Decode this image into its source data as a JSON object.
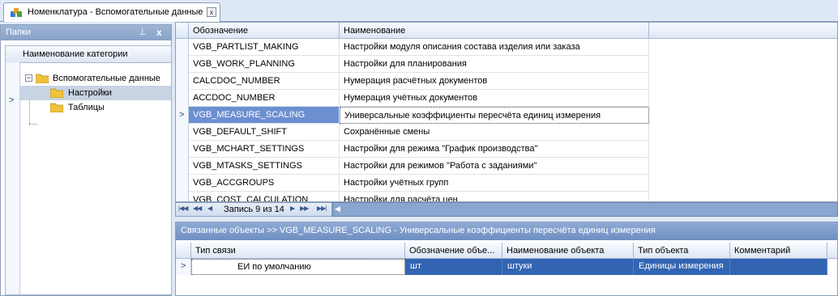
{
  "tab": {
    "title": "Номенклатура - Вспомогательные данные",
    "close_glyph": "x"
  },
  "left_panel": {
    "title": "Папки",
    "pin_glyph": "⊥",
    "close_glyph": "x",
    "tree_header": "Наименование категории",
    "tree": [
      {
        "label": "Вспомогательные данные",
        "expanded": true
      },
      {
        "label": "Настройки",
        "selected": true
      },
      {
        "label": "Таблицы"
      }
    ]
  },
  "grid": {
    "columns": [
      "Обозначение",
      "Наименование"
    ],
    "rows": [
      {
        "code": "VGB_PARTLIST_MAKING",
        "name": "Настройки модуля описания состава изделия или заказа"
      },
      {
        "code": "VGB_WORK_PLANNING",
        "name": "Настройки для планирования"
      },
      {
        "code": "CALCDOC_NUMBER",
        "name": "Нумерация расчётных документов"
      },
      {
        "code": "ACCDOC_NUMBER",
        "name": "Нумерация учётных документов"
      },
      {
        "code": "VGB_MEASURE_SCALING",
        "name": "Универсальные коэффициенты пересчёта единиц измерения",
        "selected": true
      },
      {
        "code": "VGB_DEFAULT_SHIFT",
        "name": "Сохранённые смены"
      },
      {
        "code": "VGB_MCHART_SETTINGS",
        "name": "Настройки для режима \"График производства\""
      },
      {
        "code": "VGB_MTASKS_SETTINGS",
        "name": "Настройки для режимов \"Работа с заданиями\""
      },
      {
        "code": "VGB_ACCGROUPS",
        "name": "Настройки учётных групп"
      },
      {
        "code": "VGB_COST_CALCULATION",
        "name": "Настройки для расчёта цен"
      }
    ],
    "navigator": {
      "record_text": "Запись 9 из 14"
    }
  },
  "related": {
    "caption": "Связанные объекты >> VGB_MEASURE_SCALING - Универсальные коэффициенты пересчёта единиц измерения",
    "columns": [
      "Тип связи",
      "Обозначение объе...",
      "Наименование объекта",
      "Тип объекта",
      "Комментарий"
    ],
    "row": {
      "link_type": "ЕИ по умолчанию",
      "designation": "шт",
      "object_name": "штуки",
      "object_type": "Единицы измерения",
      "comment": ""
    }
  },
  "colors": {
    "selection": "#3264b4",
    "focus_cell": "#6b8fd0",
    "panel_bg": "#dfe8f6"
  }
}
